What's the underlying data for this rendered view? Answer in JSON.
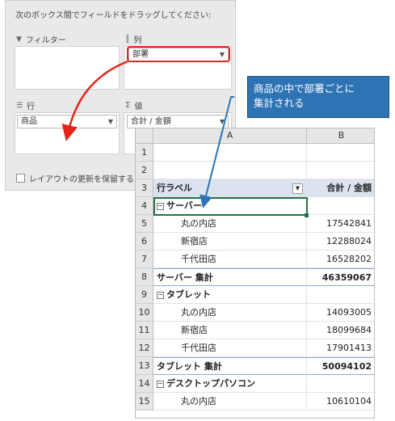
{
  "field_pane": {
    "instruction": "次のボックス間でフィールドをドラッグしてください:",
    "filter_label": "フィルター",
    "column_label": "列",
    "row_label": "行",
    "value_label": "値",
    "column_field": "部署",
    "row_field": "商品",
    "value_field": "合計 / 金額",
    "defer_update_label": "レイアウトの更新を保留する"
  },
  "callout": {
    "line1": "商品の中で部署ごとに",
    "line2": "集計される"
  },
  "sheet": {
    "col_headers": [
      "A",
      "B"
    ],
    "rows": [
      {
        "num": "1",
        "a": "",
        "b": ""
      },
      {
        "num": "2",
        "a": "",
        "b": ""
      },
      {
        "num": "3",
        "a": "行ラベル",
        "b": "合計 / 金額"
      },
      {
        "num": "4",
        "a": "サーバー",
        "b": ""
      },
      {
        "num": "5",
        "a": "丸の内店",
        "b": "17542841"
      },
      {
        "num": "6",
        "a": "新宿店",
        "b": "12288024"
      },
      {
        "num": "7",
        "a": "千代田店",
        "b": "16528202"
      },
      {
        "num": "8",
        "a": "サーバー 集計",
        "b": "46359067"
      },
      {
        "num": "9",
        "a": "タブレット",
        "b": ""
      },
      {
        "num": "10",
        "a": "丸の内店",
        "b": "14093005"
      },
      {
        "num": "11",
        "a": "新宿店",
        "b": "18099684"
      },
      {
        "num": "12",
        "a": "千代田店",
        "b": "17901413"
      },
      {
        "num": "13",
        "a": "タブレット 集計",
        "b": "50094102"
      },
      {
        "num": "14",
        "a": "デスクトップパソコン",
        "b": ""
      },
      {
        "num": "15",
        "a": "丸の内店",
        "b": "10610104"
      }
    ]
  },
  "colors": {
    "accent_red": "#e8231b",
    "callout_blue": "#2e74b5",
    "selection_green": "#217346",
    "header_band": "#dce3f0"
  }
}
